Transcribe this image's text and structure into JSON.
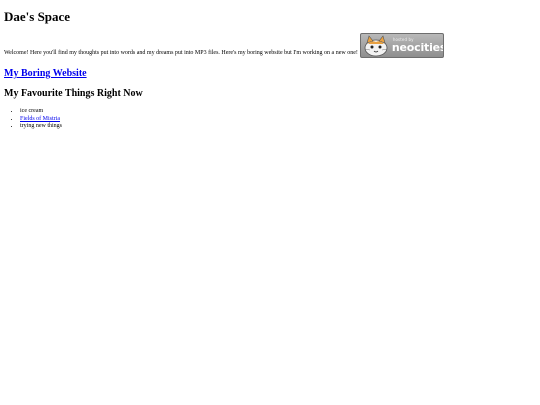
{
  "header": {
    "title": "Dae's Space"
  },
  "intro": {
    "text": "Welcome! Here you'll find my thoughts put into words and my dreams put into MP3 files. Here's my boring website but I'm working on a new one!"
  },
  "badge": {
    "hosted_by": "hosted by",
    "brand": "neocities",
    "icon": "neocities-cat-icon"
  },
  "links": {
    "boring_website": "My Boring Website"
  },
  "favourites": {
    "heading": "My Favourite Things Right Now",
    "items": [
      {
        "label": "ice cream"
      },
      {
        "label": "Fields of Mistria"
      },
      {
        "label": "trying new things"
      }
    ]
  }
}
